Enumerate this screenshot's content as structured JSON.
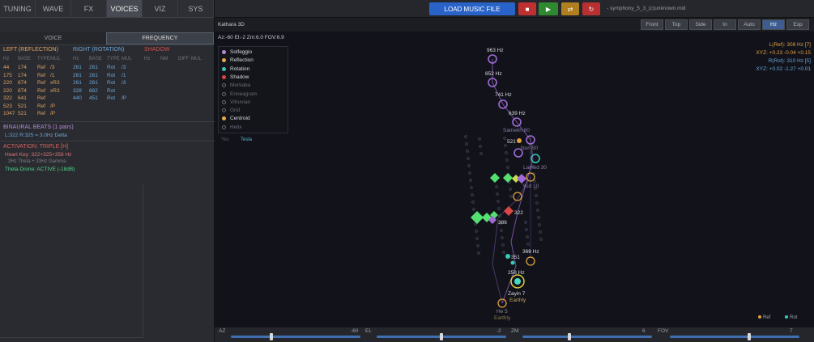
{
  "left": {
    "tabs": [
      "TUNING",
      "WAVE",
      "FX",
      "VOICES",
      "VIZ",
      "SYS"
    ],
    "active_tab": "VOICES",
    "subtabs": [
      "VOICE",
      "FREQUENCY"
    ],
    "active_subtab": "FREQUENCY",
    "reflection": {
      "title": "LEFT (REFLECTION)",
      "headers": [
        "Hz",
        "BASE",
        "TYPE",
        "MUL"
      ],
      "rows": [
        [
          "44",
          "174",
          "Ref",
          "/3"
        ],
        [
          "175",
          "174",
          "Ref",
          "/1"
        ],
        [
          "220",
          "874",
          "Ref",
          "xR3"
        ],
        [
          "220",
          "874",
          "Ref",
          "xR3"
        ],
        [
          "322",
          "641",
          "Ref",
          ""
        ],
        [
          "523",
          "521",
          "Ref",
          "/P"
        ],
        [
          "1047",
          "521",
          "Ref",
          "/P"
        ]
      ]
    },
    "rotation": {
      "title": "RIGHT (ROTATION)",
      "headers": [
        "Hz",
        "BASE",
        "TYPE",
        "MUL"
      ],
      "rows": [
        [
          "261",
          "261",
          "Rot",
          "/3"
        ],
        [
          "261",
          "261",
          "Rot",
          "/1"
        ],
        [
          "261",
          "261",
          "Rot",
          "/3"
        ],
        [
          "328",
          "682",
          "Rot",
          ""
        ],
        [
          "440",
          "451",
          "Rot",
          "/P"
        ]
      ]
    },
    "shadow": {
      "title": "SHADOW",
      "headers": [
        "Hz",
        "NM",
        "DIFF",
        "MUL"
      ]
    },
    "binaural": {
      "title": "BINAURAL BEATS (1 pairs)",
      "line": "L:322 R:325 = 3.0Hz Delta"
    },
    "activation": {
      "title": "ACTIVATION: TRIPLE [H]",
      "heart_key": "Heart Key: 322+325+358 Hz",
      "theta": "3Hz Theta + 33Hz Gamma",
      "drone": "Theta Drone: ACTIVE (-18dB)"
    }
  },
  "topbar": {
    "load_label": "LOAD MUSIC FILE",
    "stop_icon": "■",
    "play_icon": "▶",
    "loop_icon": "⇄",
    "restart_icon": "↻",
    "filename": "- symphony_5_3_(c)unknown.mid"
  },
  "viewbar": {
    "title": "Kathara 3D",
    "views": [
      "Front",
      "Top",
      "Side",
      "In",
      "Auto",
      "Hz",
      "Exp"
    ],
    "active_view": "Hz"
  },
  "camera": "Az:-60  El:-2  Zm:6.0  FOV:6.9",
  "legend": {
    "items": [
      {
        "label": "Solfeggio",
        "color": "#b48bd8",
        "filled": true
      },
      {
        "label": "Reflection",
        "color": "#e8a94c",
        "filled": true
      },
      {
        "label": "Rotation",
        "color": "#39c7b8",
        "filled": true
      },
      {
        "label": "Shadow",
        "color": "#d94646",
        "filled": true
      },
      {
        "label": "Merkaba",
        "color": "#6a6c74",
        "filled": false
      },
      {
        "label": "Enneagram",
        "color": "#6a6c74",
        "filled": false
      },
      {
        "label": "Vitruvian",
        "color": "#6a6c74",
        "filled": false
      },
      {
        "label": "Grid",
        "color": "#6a6c74",
        "filled": false
      },
      {
        "label": "Centroid",
        "color": "#e8a94c",
        "filled": true
      },
      {
        "label": "Helix",
        "color": "#6a6c74",
        "filled": false
      }
    ],
    "mode_tabs": [
      "Yes",
      "Tesla"
    ]
  },
  "readout": {
    "l_ref": "L(Ref): 308 Hz  [7]",
    "l_xyz": "XYZ: +0.23 -0.04 +0.15",
    "r_rot": "R(Rot): 310 Hz  [5]",
    "r_xyz": "XYZ: +0.02 -1.27 +0.01"
  },
  "scene": {
    "nodes": [
      {
        "label": "963 Hz"
      },
      {
        "label": "852 Hz"
      },
      {
        "label": "741 Hz"
      },
      {
        "label": "639 Hz"
      },
      {
        "label": "Samekh 60"
      },
      {
        "label": "521"
      },
      {
        "label": "Nun 50"
      },
      {
        "label": "Lamed 30"
      },
      {
        "label": "Yud 10"
      },
      {
        "label": "322"
      },
      {
        "label": "386"
      },
      {
        "label": "351"
      },
      {
        "label": "369 Hz"
      },
      {
        "label": "258 Hz"
      },
      {
        "label": "Zayin 7"
      },
      {
        "label": "Earthly"
      },
      {
        "label": "He 5"
      },
      {
        "label": "Earthly"
      }
    ],
    "corner_legend": [
      "Ref",
      "Rot"
    ]
  },
  "sliders": [
    {
      "label": "AZ",
      "value": "-60",
      "fraction": 0.3
    },
    {
      "label": "EL",
      "value": "-2",
      "fraction": 0.49
    },
    {
      "label": "ZM",
      "value": "6",
      "fraction": 0.35
    },
    {
      "label": "FOV",
      "value": "7",
      "fraction": 0.6
    }
  ],
  "colors": {
    "solfeggio": "#a06ad6",
    "reflection": "#e0a040",
    "rotation": "#3ac8b8",
    "shadow": "#d94646",
    "accent": "#2a63c8"
  }
}
